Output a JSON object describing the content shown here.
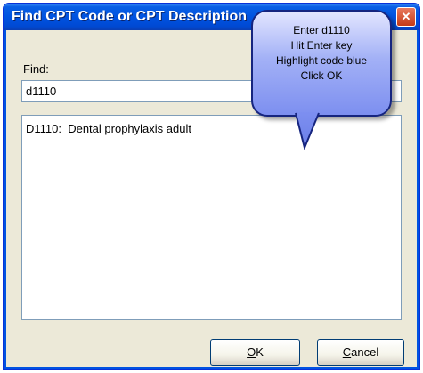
{
  "window": {
    "title": "Find CPT Code or CPT Description",
    "close_symbol": "✕"
  },
  "find": {
    "label": "Find:",
    "value": "d1110"
  },
  "results": {
    "items": [
      "D1110:  Dental prophylaxis adult"
    ]
  },
  "buttons": {
    "ok": {
      "accel": "O",
      "rest": "K"
    },
    "cancel": {
      "accel": "C",
      "rest": "ancel"
    }
  },
  "callout": {
    "lines": [
      "Enter d1110",
      "Hit Enter key",
      "Highlight code blue",
      "Click OK"
    ]
  },
  "colors": {
    "titlebar": "#0053e1",
    "dialog_bg": "#ece9d8",
    "callout_fill": "#a3b1f6",
    "callout_border": "#16257f"
  }
}
